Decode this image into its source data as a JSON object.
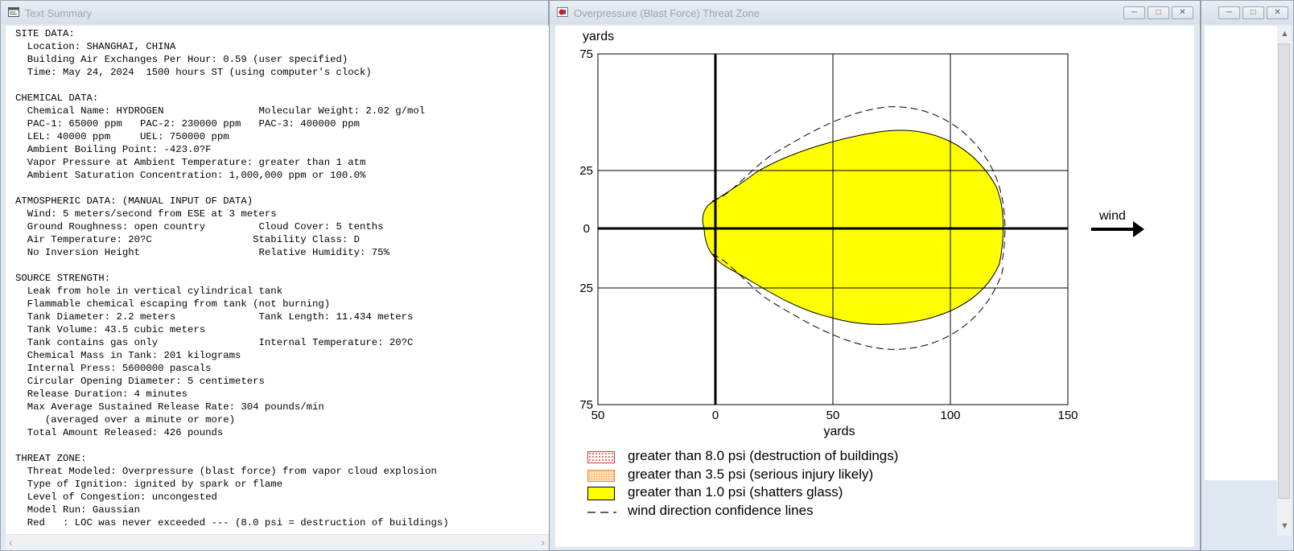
{
  "text_window": {
    "title": "Text Summary",
    "lines": [
      "SITE DATA:",
      "  Location: SHANGHAI, CHINA",
      "  Building Air Exchanges Per Hour: 0.59 (user specified)",
      "  Time: May 24, 2024  1500 hours ST (using computer's clock)",
      "",
      "CHEMICAL DATA:",
      "  Chemical Name: HYDROGEN                Molecular Weight: 2.02 g/mol",
      "  PAC-1: 65000 ppm   PAC-2: 230000 ppm   PAC-3: 400000 ppm",
      "  LEL: 40000 ppm     UEL: 750000 ppm",
      "  Ambient Boiling Point: -423.0?F",
      "  Vapor Pressure at Ambient Temperature: greater than 1 atm",
      "  Ambient Saturation Concentration: 1,000,000 ppm or 100.0%",
      "",
      "ATMOSPHERIC DATA: (MANUAL INPUT OF DATA)",
      "  Wind: 5 meters/second from ESE at 3 meters",
      "  Ground Roughness: open country         Cloud Cover: 5 tenths",
      "  Air Temperature: 20?C                 Stability Class: D",
      "  No Inversion Height                    Relative Humidity: 75%",
      "",
      "SOURCE STRENGTH:",
      "  Leak from hole in vertical cylindrical tank",
      "  Flammable chemical escaping from tank (not burning)",
      "  Tank Diameter: 2.2 meters              Tank Length: 11.434 meters",
      "  Tank Volume: 43.5 cubic meters",
      "  Tank contains gas only                 Internal Temperature: 20?C",
      "  Chemical Mass in Tank: 201 kilograms",
      "  Internal Press: 5600000 pascals",
      "  Circular Opening Diameter: 5 centimeters",
      "  Release Duration: 4 minutes",
      "  Max Average Sustained Release Rate: 304 pounds/min",
      "     (averaged over a minute or more)",
      "  Total Amount Released: 426 pounds",
      "",
      "THREAT ZONE:",
      "  Threat Modeled: Overpressure (blast force) from vapor cloud explosion",
      "  Type of Ignition: ignited by spark or flame",
      "  Level of Congestion: uncongested",
      "  Model Run: Gaussian",
      "  Red   : LOC was never exceeded --- (8.0 psi = destruction of buildings)"
    ]
  },
  "map_window": {
    "title": "Overpressure (Blast Force) Threat Zone",
    "y_axis_label": "yards",
    "x_axis_label": "yards",
    "wind_label": "wind",
    "x_ticks": [
      "50",
      "0",
      "50",
      "100",
      "150"
    ],
    "y_ticks": [
      "75",
      "25",
      "0",
      "25",
      "75"
    ],
    "zone_color": "#ffff00",
    "legend": [
      {
        "label": "greater than 8.0 psi (destruction of buildings)",
        "color": "#ff5a5a"
      },
      {
        "label": "greater than 3.5 psi (serious injury likely)",
        "color": "#ff9933"
      },
      {
        "label": "greater than 1.0 psi (shatters glass)",
        "color": "#ffff00"
      },
      {
        "label": "wind direction confidence lines",
        "color": "#000000"
      }
    ]
  },
  "window_controls": {
    "minimize": "─",
    "maximize": "□",
    "close": "✕"
  }
}
